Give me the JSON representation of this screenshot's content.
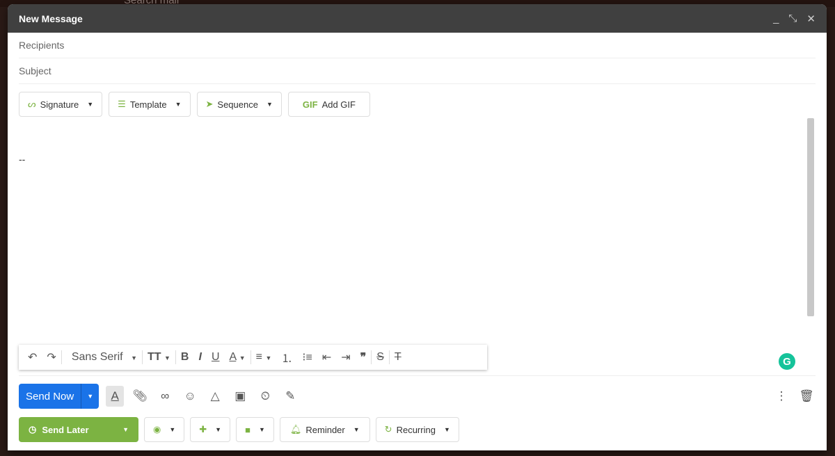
{
  "background": {
    "search_placeholder": "Search mail"
  },
  "compose": {
    "title": "New Message",
    "controls": {
      "minimize": "_",
      "fullscreen_exit": "⤡",
      "close": "✕"
    },
    "recipients_placeholder": "Recipients",
    "subject_placeholder": "Subject",
    "chips": [
      {
        "label": "Signature",
        "icon": "signature-icon"
      },
      {
        "label": "Template",
        "icon": "template-icon"
      },
      {
        "label": "Sequence",
        "icon": "send-icon"
      },
      {
        "label": "Add GIF",
        "icon": "gif-icon",
        "icon_text": "GIF"
      }
    ],
    "body_text": "--",
    "format": {
      "font": "Sans Serif"
    },
    "send_now": "Send Now",
    "send_later": "Send Later",
    "reminder": "Reminder",
    "recurring": "Recurring",
    "accent_green": "#7cb342",
    "accent_blue": "#1a73e8"
  }
}
